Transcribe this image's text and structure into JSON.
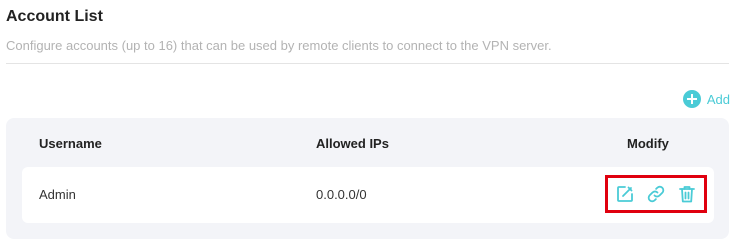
{
  "section": {
    "title": "Account List",
    "description": "Configure accounts (up to 16) that can be used by remote clients to connect to the VPN server."
  },
  "toolbar": {
    "add_label": "Add",
    "add_icon": "plus-circle-icon"
  },
  "table": {
    "columns": [
      "Username",
      "Allowed IPs",
      "Modify"
    ],
    "rows": [
      {
        "username": "Admin",
        "allowed_ips": "0.0.0.0/0",
        "actions": [
          "edit-icon",
          "link-icon",
          "trash-icon"
        ]
      }
    ]
  },
  "colors": {
    "accent": "#4acbd6",
    "highlight_box": "#e0000f",
    "card_bg": "#f3f4f8"
  }
}
